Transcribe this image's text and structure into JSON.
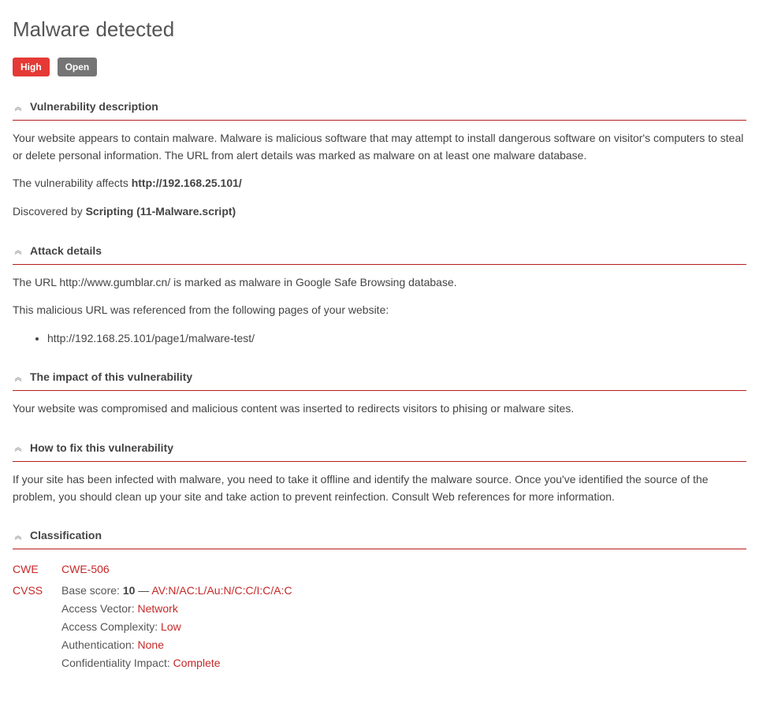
{
  "title": "Malware detected",
  "badges": {
    "severity": "High",
    "status": "Open"
  },
  "sections": {
    "description": {
      "heading": "Vulnerability description",
      "intro": "Your website appears to contain malware. Malware is malicious software that may attempt to install dangerous software on visitor's computers to steal or delete personal information. The URL from alert details was marked as malware on at least one malware database.",
      "affects_prefix": "The vulnerability affects ",
      "affects_url": "http://192.168.25.101/",
      "discovered_prefix": "Discovered by ",
      "discovered_by": "Scripting (11-Malware.script)"
    },
    "attack": {
      "heading": "Attack details",
      "line1": "The URL http://www.gumblar.cn/ is marked as malware in Google Safe Browsing database.",
      "line2": "This malicious URL was referenced from the following pages of your website:",
      "refs": [
        "http://192.168.25.101/page1/malware-test/"
      ]
    },
    "impact": {
      "heading": "The impact of this vulnerability",
      "text": "Your website was compromised and malicious content was inserted to redirects visitors to phising or malware sites."
    },
    "fix": {
      "heading": "How to fix this vulnerability",
      "text": "If your site has been infected with malware, you need to take it offline and identify the malware source. Once you've identified the source of the problem, you should clean up your site and take action to prevent reinfection. Consult Web references for more information."
    },
    "classification": {
      "heading": "Classification",
      "cwe_label": "CWE",
      "cwe_value": "CWE-506",
      "cvss_label": "CVSS",
      "base_prefix": "Base score:  ",
      "base_score": "10",
      "base_sep": " — ",
      "vector": "AV:N/AC:L/Au:N/C:C/I:C/A:C",
      "metrics": [
        {
          "label": "Access Vector: ",
          "value": "Network"
        },
        {
          "label": "Access Complexity: ",
          "value": "Low"
        },
        {
          "label": "Authentication: ",
          "value": "None"
        },
        {
          "label": "Confidentiality Impact: ",
          "value": "Complete"
        }
      ]
    }
  }
}
